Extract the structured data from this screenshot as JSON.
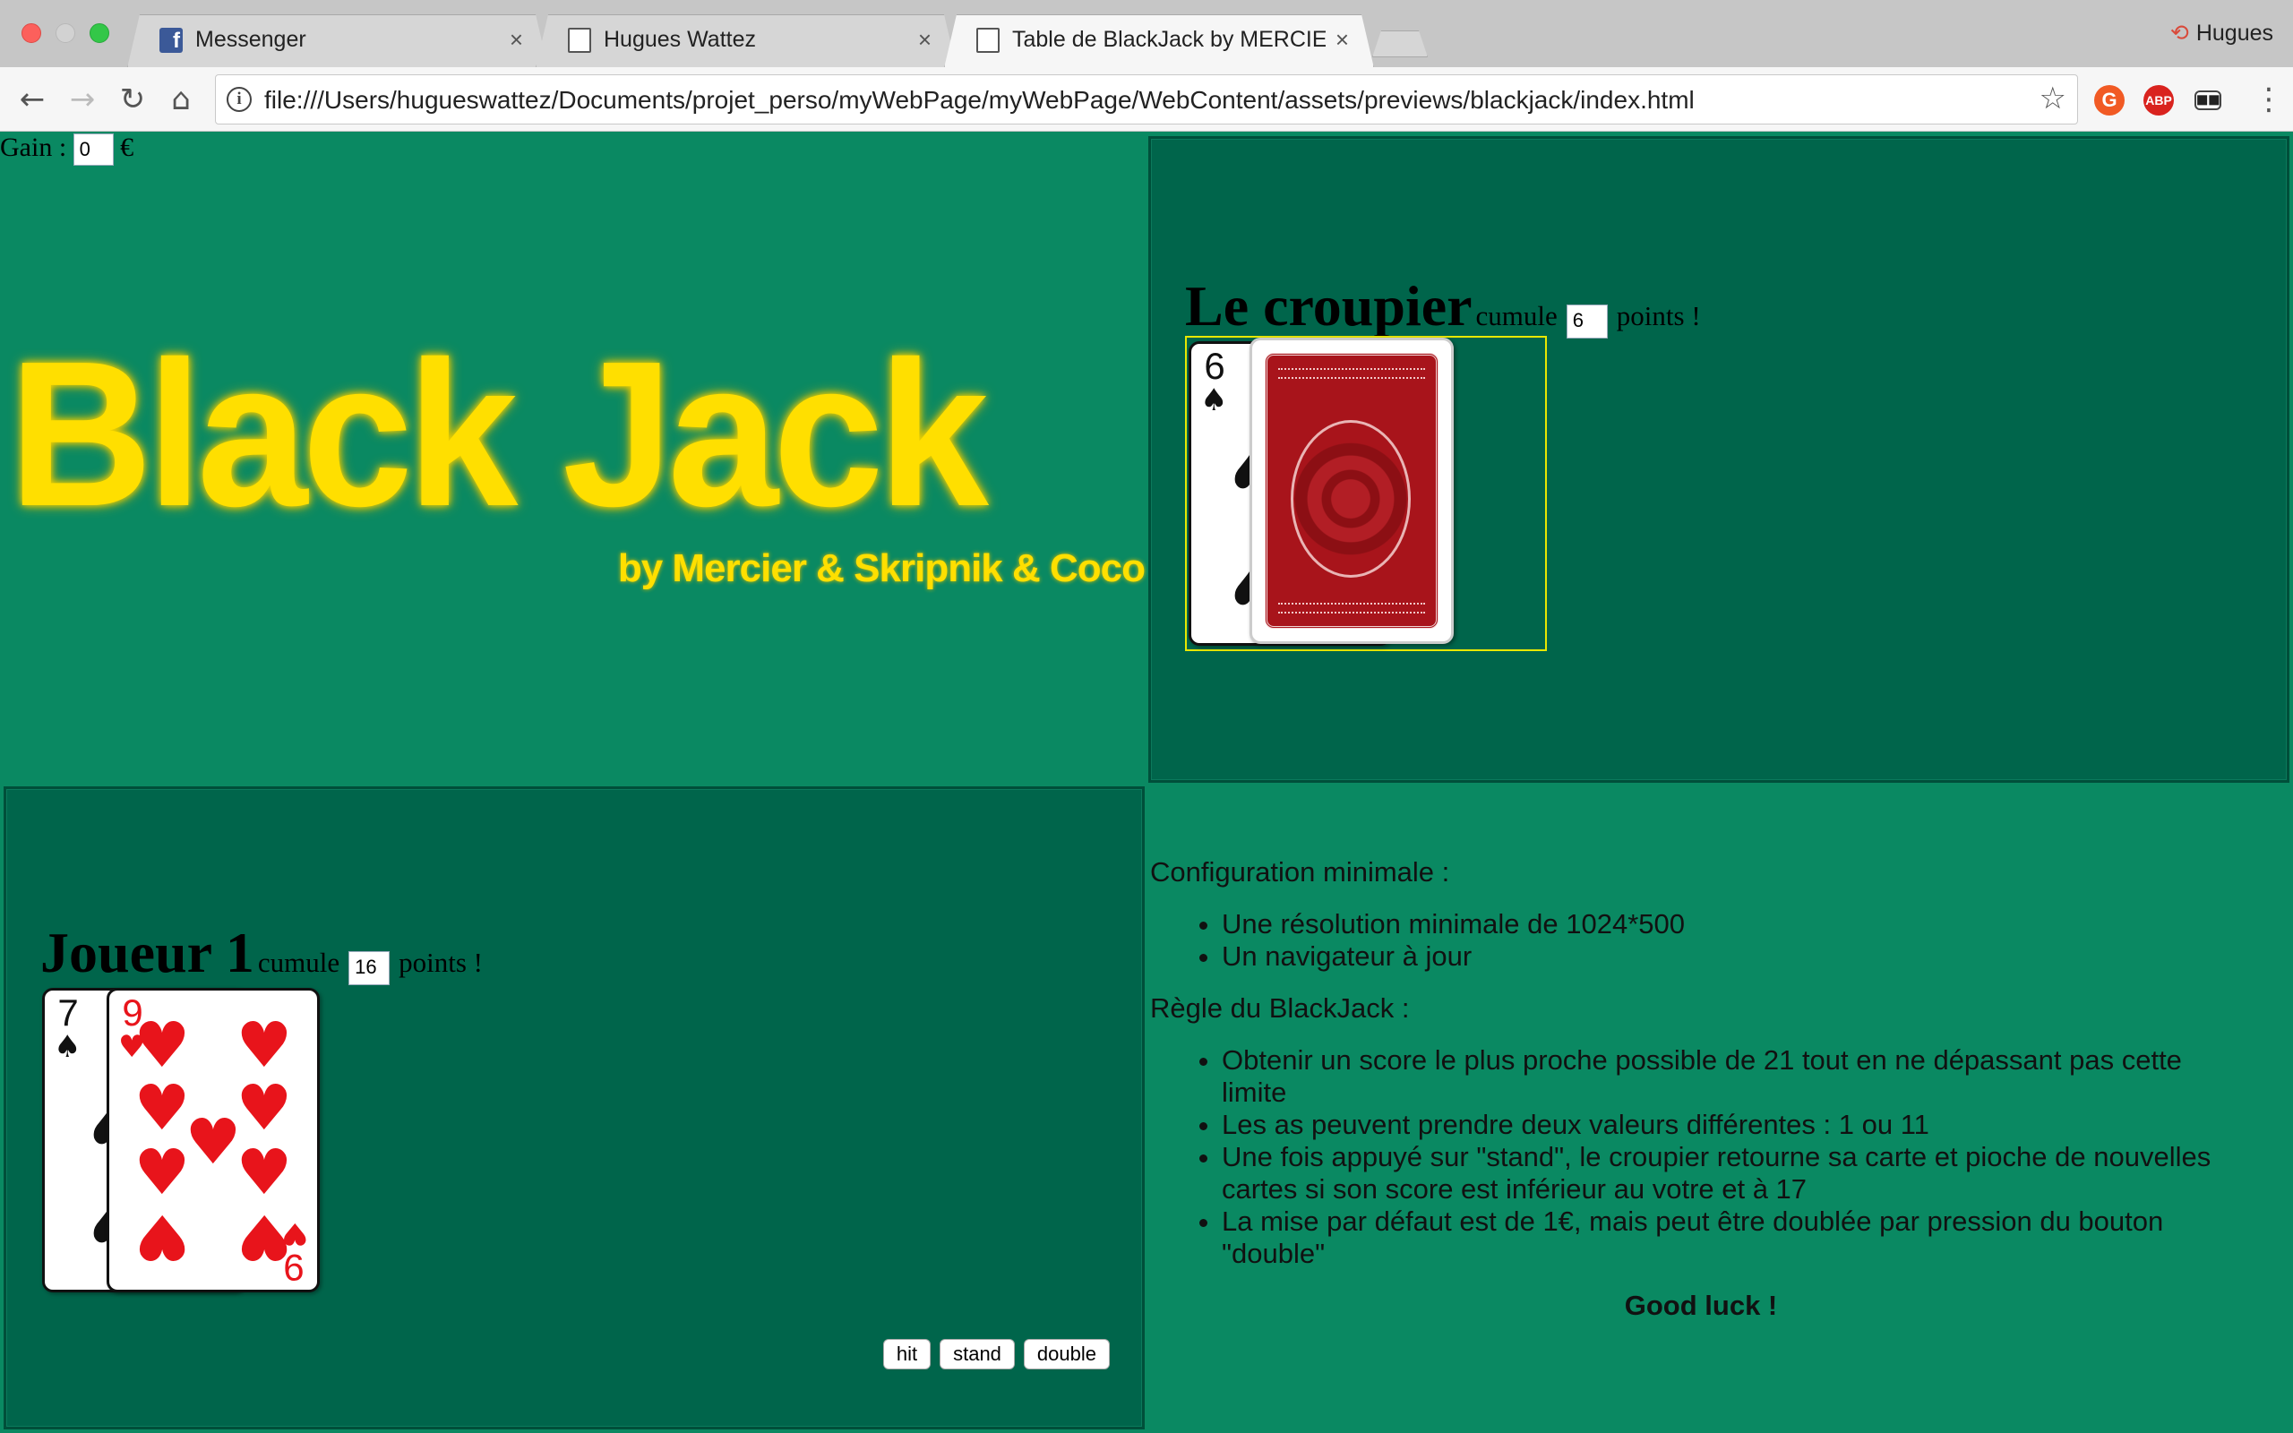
{
  "browser": {
    "tabs": [
      {
        "label": "Messenger",
        "icon": "facebook-icon",
        "active": false
      },
      {
        "label": "Hugues Wattez",
        "icon": "document-icon",
        "active": false
      },
      {
        "label": "Table de BlackJack by MERCIE",
        "icon": "document-icon",
        "active": true
      }
    ],
    "profile_name": "Hugues",
    "url": "file:///Users/hugueswattez/Documents/projet_perso/myWebPage/myWebPage/WebContent/assets/previews/blackjack/index.html",
    "extensions": [
      "grammarly-icon",
      "adblock-plus-icon",
      "incognito-mask-icon"
    ]
  },
  "game": {
    "gain_label": "Gain :",
    "gain_value": "0",
    "currency": "€",
    "title": "Black Jack",
    "subtitle": "by Mercier & Skripnik & Coco",
    "dealer": {
      "name": "Le croupier",
      "cumule_label": "cumule",
      "points": "6",
      "points_label": "points !",
      "cards": [
        {
          "rank": "6",
          "suit": "♠",
          "color": "black"
        },
        {
          "face": "down"
        }
      ]
    },
    "player": {
      "name": "Joueur 1",
      "cumule_label": "cumule",
      "points": "16",
      "points_label": "points !",
      "cards": [
        {
          "rank": "7",
          "suit": "♠",
          "color": "black"
        },
        {
          "rank": "9",
          "suit": "♥",
          "color": "red"
        }
      ]
    },
    "actions": {
      "hit": "hit",
      "stand": "stand",
      "double": "double"
    }
  },
  "info": {
    "config_title": "Configuration minimale :",
    "config_items": [
      "Une résolution minimale de 1024*500",
      "Un navigateur à jour"
    ],
    "rules_title": "Règle du BlackJack :",
    "rules_items": [
      "Obtenir un score le plus proche possible de 21 tout en ne dépassant pas cette limite",
      "Les as peuvent prendre deux valeurs différentes : 1 ou 11",
      "Une fois appuyé sur \"stand\", le croupier retourne sa carte et pioche de nouvelles cartes si son score est inférieur au votre et à 17",
      "La mise par défaut est de 1€, mais peut être doublée par pression du bouton \"double\""
    ],
    "good_luck": "Good luck !"
  }
}
